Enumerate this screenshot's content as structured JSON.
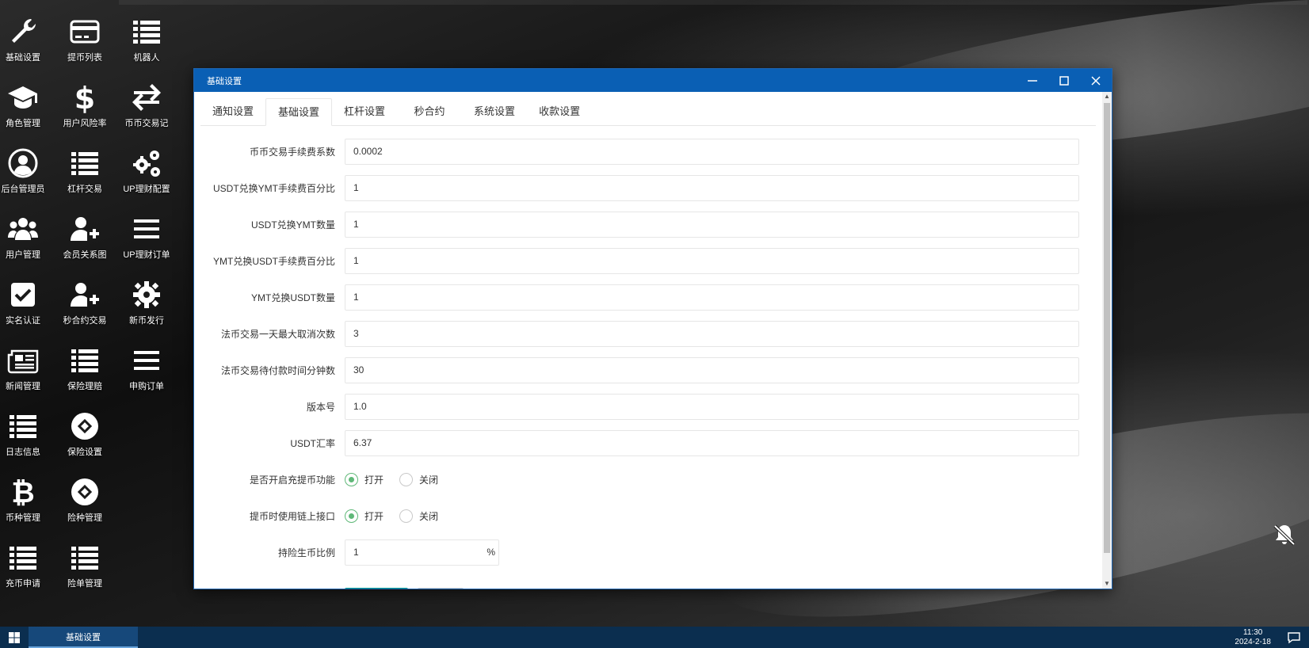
{
  "desktop_icons": [
    {
      "label": "基础设置",
      "icon": "wrench-icon"
    },
    {
      "label": "提币列表",
      "icon": "card-icon"
    },
    {
      "label": "机器人",
      "icon": "list-icon"
    },
    {
      "label": "角色管理",
      "icon": "graduation-cap-icon"
    },
    {
      "label": "用户风险率",
      "icon": "dollar-icon"
    },
    {
      "label": "币币交易记",
      "icon": "exchange-arrows-icon"
    },
    {
      "label": "后台管理员",
      "icon": "user-circle-icon"
    },
    {
      "label": "杠杆交易",
      "icon": "list-icon"
    },
    {
      "label": "UP理财配置",
      "icon": "gears-icon"
    },
    {
      "label": "用户管理",
      "icon": "users-icon"
    },
    {
      "label": "会员关系图",
      "icon": "user-plus-icon"
    },
    {
      "label": "UP理财订单",
      "icon": "menu-icon"
    },
    {
      "label": "实名认证",
      "icon": "check-square-icon"
    },
    {
      "label": "秒合约交易",
      "icon": "user-plus-icon"
    },
    {
      "label": "新币发行",
      "icon": "gear-icon"
    },
    {
      "label": "新闻管理",
      "icon": "newspaper-icon"
    },
    {
      "label": "保险理赔",
      "icon": "list-icon"
    },
    {
      "label": "申购订单",
      "icon": "menu-icon"
    },
    {
      "label": "日志信息",
      "icon": "list-icon"
    },
    {
      "label": "保险设置",
      "icon": "chain-circle-icon"
    },
    {
      "label": "币种管理",
      "icon": "bitcoin-icon"
    },
    {
      "label": "险种管理",
      "icon": "chain-circle-icon"
    },
    {
      "label": "充币申请",
      "icon": "list-icon"
    },
    {
      "label": "险单管理",
      "icon": "list-icon"
    }
  ],
  "dialog": {
    "title": "基础设置",
    "tabs": [
      "通知设置",
      "基础设置",
      "杠杆设置",
      "秒合约",
      "系统设置",
      "收款设置"
    ],
    "active_tab": "基础设置",
    "fields": [
      {
        "label": "币币交易手续费系数",
        "value": "0.0002"
      },
      {
        "label": "USDT兑换YMT手续费百分比",
        "value": "1"
      },
      {
        "label": "USDT兑换YMT数量",
        "value": "1"
      },
      {
        "label": "YMT兑换USDT手续费百分比",
        "value": "1"
      },
      {
        "label": "YMT兑换USDT数量",
        "value": "1"
      },
      {
        "label": "法币交易一天最大取消次数",
        "value": "3"
      },
      {
        "label": "法币交易待付款时间分钟数",
        "value": "30"
      },
      {
        "label": "版本号",
        "value": "1.0"
      },
      {
        "label": "USDT汇率",
        "value": "6.37"
      }
    ],
    "radios": [
      {
        "label": "是否开启充提币功能",
        "on": "打开",
        "off": "关闭",
        "selected": "打开"
      },
      {
        "label": "提币时使用链上接口",
        "on": "打开",
        "off": "关闭",
        "selected": "打开"
      }
    ],
    "ratio": {
      "label": "持险生币比例",
      "value": "1",
      "unit": "%"
    }
  },
  "taskbar": {
    "task_label": "基础设置",
    "time": "11:30",
    "date": "2024-2-18"
  },
  "colors": {
    "titlebar": "#0a5fb4",
    "taskbar": "#0b2e4f",
    "radio_on": "#5fb878",
    "primary_button": "#009688"
  }
}
